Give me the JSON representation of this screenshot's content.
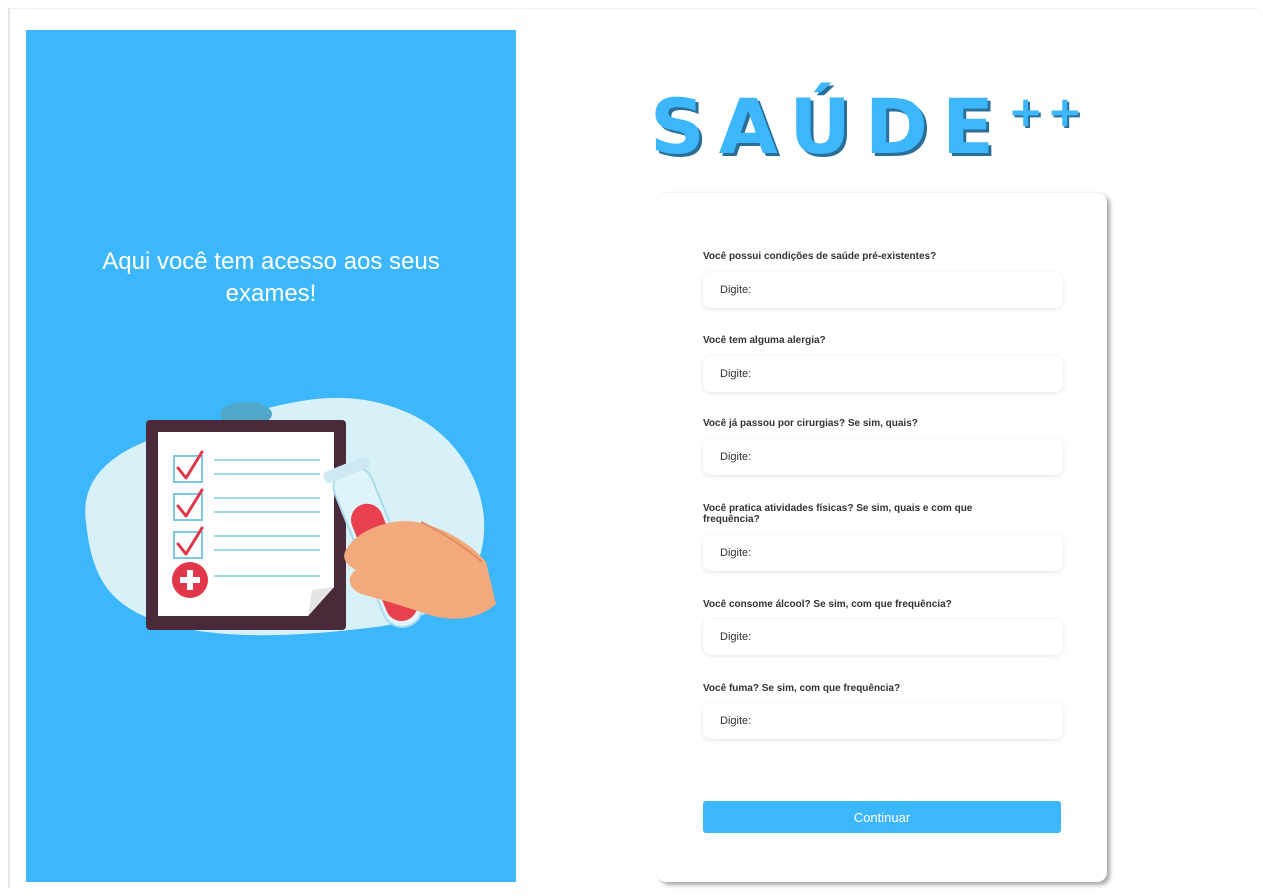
{
  "left_panel": {
    "heading": "Aqui você tem acesso aos seus exames!",
    "background_color": "#3db7fb",
    "illustration": "clipboard-checklist-and-test-tube-illustration"
  },
  "logo": {
    "text": "SAÚDE",
    "suffix": "++",
    "color": "#3db7fb"
  },
  "form": {
    "fields": [
      {
        "label": "Você possui condições de saúde pré-existentes?",
        "placeholder": "Digite:"
      },
      {
        "label": "Você tem alguma alergia?",
        "placeholder": "Digite:"
      },
      {
        "label": "Você já passou por cirurgias? Se sim, quais?",
        "placeholder": "Digite:"
      },
      {
        "label": "Você pratica atividades físicas? Se sim, quais e com que frequência?",
        "placeholder": "Digite:"
      },
      {
        "label": "Você consome álcool? Se sim, com que frequência?",
        "placeholder": "Digite:"
      },
      {
        "label": "Você fuma? Se sim, com que frequência?",
        "placeholder": "Digite:"
      }
    ],
    "submit_label": "Continuar",
    "accent_color": "#3db7fb"
  }
}
